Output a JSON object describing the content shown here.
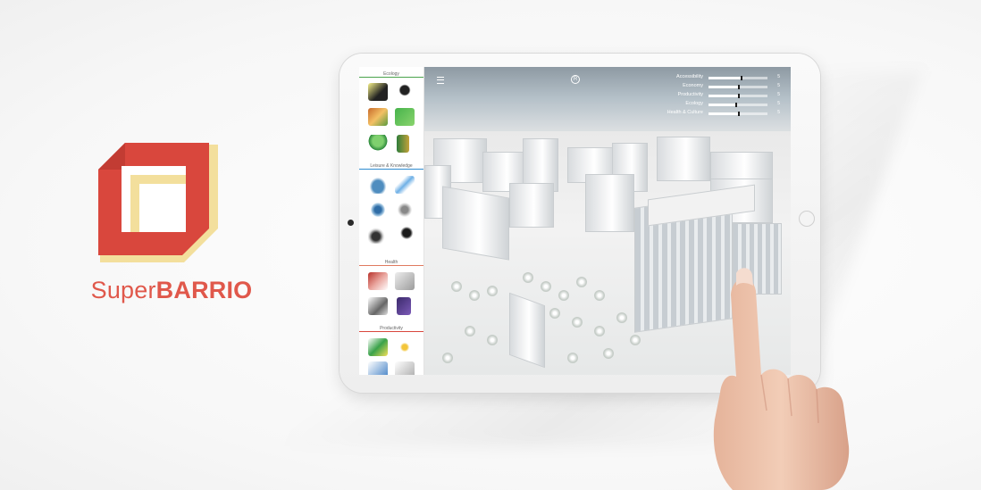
{
  "brand": {
    "name_light": "Super",
    "name_bold": "BARRIO",
    "color": "#e0584b",
    "logo_colors": {
      "outer": "#d9473d",
      "inner_fold": "#f3df9c",
      "face": "#e85c4f"
    }
  },
  "app": {
    "center_icon": "R",
    "sidebar": {
      "sections": [
        {
          "label": "Ecology",
          "color": "#4aa34c"
        },
        {
          "label": "Leisure & Knowledge",
          "color": "#2d8bd0"
        },
        {
          "label": "Health",
          "color": "#e07a5f"
        },
        {
          "label": "Productivity",
          "color": "#d9473d"
        }
      ]
    },
    "metrics": [
      {
        "label": "Accessibility",
        "value": 0.55,
        "readout": "5"
      },
      {
        "label": "Economy",
        "value": 0.5,
        "readout": "5"
      },
      {
        "label": "Productivity",
        "value": 0.5,
        "readout": "5"
      },
      {
        "label": "Ecology",
        "value": 0.45,
        "readout": "5"
      },
      {
        "label": "Health & Culture",
        "value": 0.5,
        "readout": "5"
      }
    ]
  }
}
